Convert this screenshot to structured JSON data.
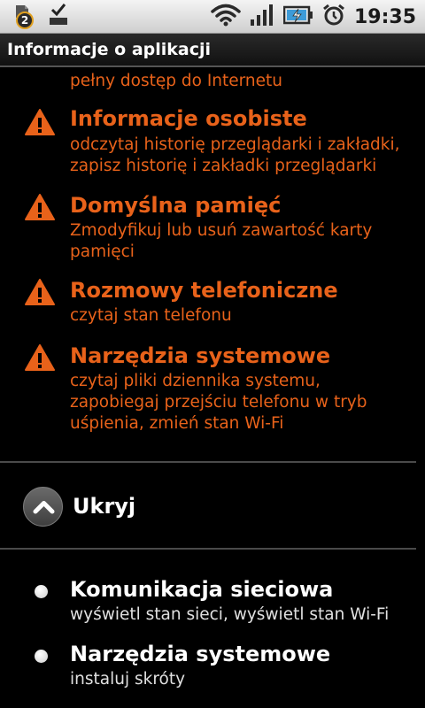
{
  "status_bar": {
    "notification_count": "2",
    "time": "19:35",
    "icons": [
      "notification-badge-icon",
      "download-complete-icon",
      "wifi-icon",
      "signal-icon",
      "battery-charging-icon",
      "alarm-icon"
    ]
  },
  "title_bar": {
    "title": "Informacje o aplikacji"
  },
  "cut_off_desc": "pełny dostęp do Internetu",
  "permissions": [
    {
      "title": "Informacje osobiste",
      "desc": "odczytaj historię przeglądarki i zakładki, zapisz historię i zakładki przeglądarki"
    },
    {
      "title": "Domyślna pamięć",
      "desc": "Zmodyfikuj lub usuń zawartość karty pamięci"
    },
    {
      "title": "Rozmowy telefoniczne",
      "desc": "czytaj stan telefonu"
    },
    {
      "title": "Narzędzia systemowe",
      "desc": "czytaj pliki dziennika systemu, zapobiegaj przejściu telefonu w tryb uśpienia, zmień stan Wi-Fi"
    }
  ],
  "toggle": {
    "label": "Ukryj"
  },
  "other_permissions": [
    {
      "title": "Komunikacja sieciowa",
      "desc": "wyświetl stan sieci, wyświetl stan Wi-Fi"
    },
    {
      "title": "Narzędzia systemowe",
      "desc": "instaluj skróty"
    }
  ],
  "colors": {
    "warning": "#e8621a",
    "background": "#000000",
    "text": "#ffffff"
  }
}
